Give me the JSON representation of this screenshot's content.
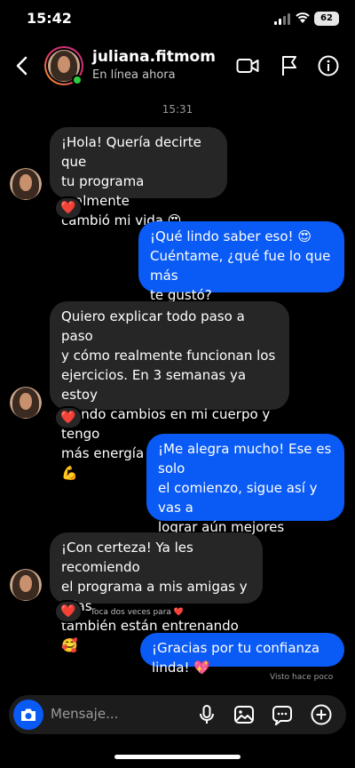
{
  "status_bar": {
    "time": "15:42",
    "battery": "62"
  },
  "header": {
    "name": "juliana.fitmom",
    "status": "En línea ahora"
  },
  "conversation": {
    "timestamp": "15:31",
    "messages": [
      {
        "from": "them",
        "text": "¡Hola! Quería decirte que\ntu programa realmente\ncambió mi vida 😍",
        "reaction": "❤️"
      },
      {
        "from": "me",
        "text": "¡Qué lindo saber eso! 😍\nCuéntame, ¿qué fue lo que más\nte gustó?"
      },
      {
        "from": "them",
        "text": "Quiero explicar todo paso a paso\ny cómo realmente funcionan los\nejercicios. En 3 semanas ya estoy\nviendo cambios en mi cuerpo y tengo\nmás energía para mi día a día 💪",
        "reaction": "❤️"
      },
      {
        "from": "me",
        "text": "¡Me alegra mucho! Ese es solo\nel comienzo, sigue así y vas a\nlograr aún mejores resultados\n🔥"
      },
      {
        "from": "them",
        "text": "¡Con certeza! Ya les recomiendo\nel programa a mis amigas y ellas\ntambién están entrenando🥰",
        "reaction": "❤️"
      },
      {
        "from": "me",
        "text": "¡Gracias por tu confianza linda! 💖"
      }
    ],
    "double_tap_hint": "Toca dos veces para ❤️",
    "seen_label": "Visto hace poco"
  },
  "composer": {
    "placeholder": "Mensaje..."
  },
  "colors": {
    "outgoing_bubble": "#0a5af5",
    "incoming_bubble": "#262626",
    "background": "#000000"
  }
}
